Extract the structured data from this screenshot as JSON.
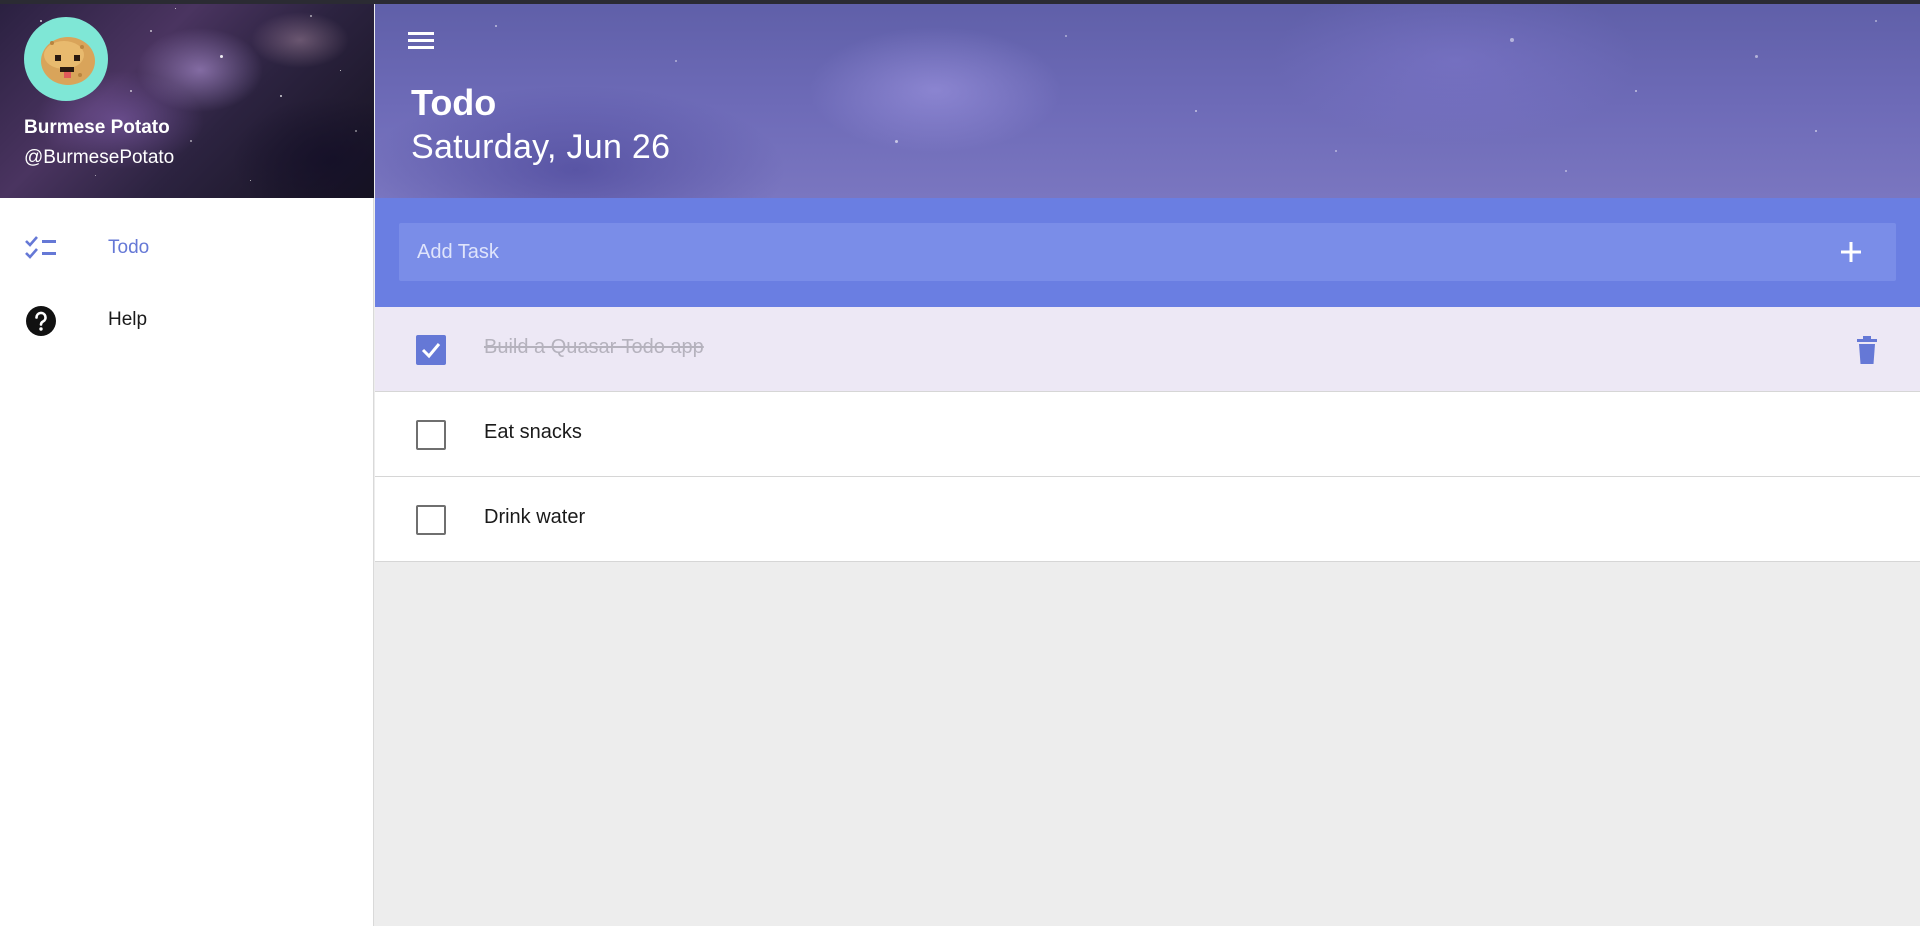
{
  "profile": {
    "name": "Burmese Potato",
    "handle": "@BurmesePotato"
  },
  "sidebar": {
    "items": [
      {
        "label": "Todo",
        "icon": "checklist-icon",
        "active": true
      },
      {
        "label": "Help",
        "icon": "help-circle-icon",
        "active": false
      }
    ]
  },
  "header": {
    "menu_icon": "menu-icon",
    "title": "Todo",
    "date": "Saturday, Jun 26"
  },
  "add_task": {
    "placeholder": "Add Task",
    "value": "",
    "button_icon": "plus-icon"
  },
  "tasks": [
    {
      "text": "Build a Quasar Todo app",
      "done": true
    },
    {
      "text": "Eat snacks",
      "done": false
    },
    {
      "text": "Drink water",
      "done": false
    }
  ],
  "colors": {
    "accent": "#6578d6",
    "add_bar": "#6a7ee2",
    "done_row": "#ede8f5",
    "background": "#ededed"
  }
}
